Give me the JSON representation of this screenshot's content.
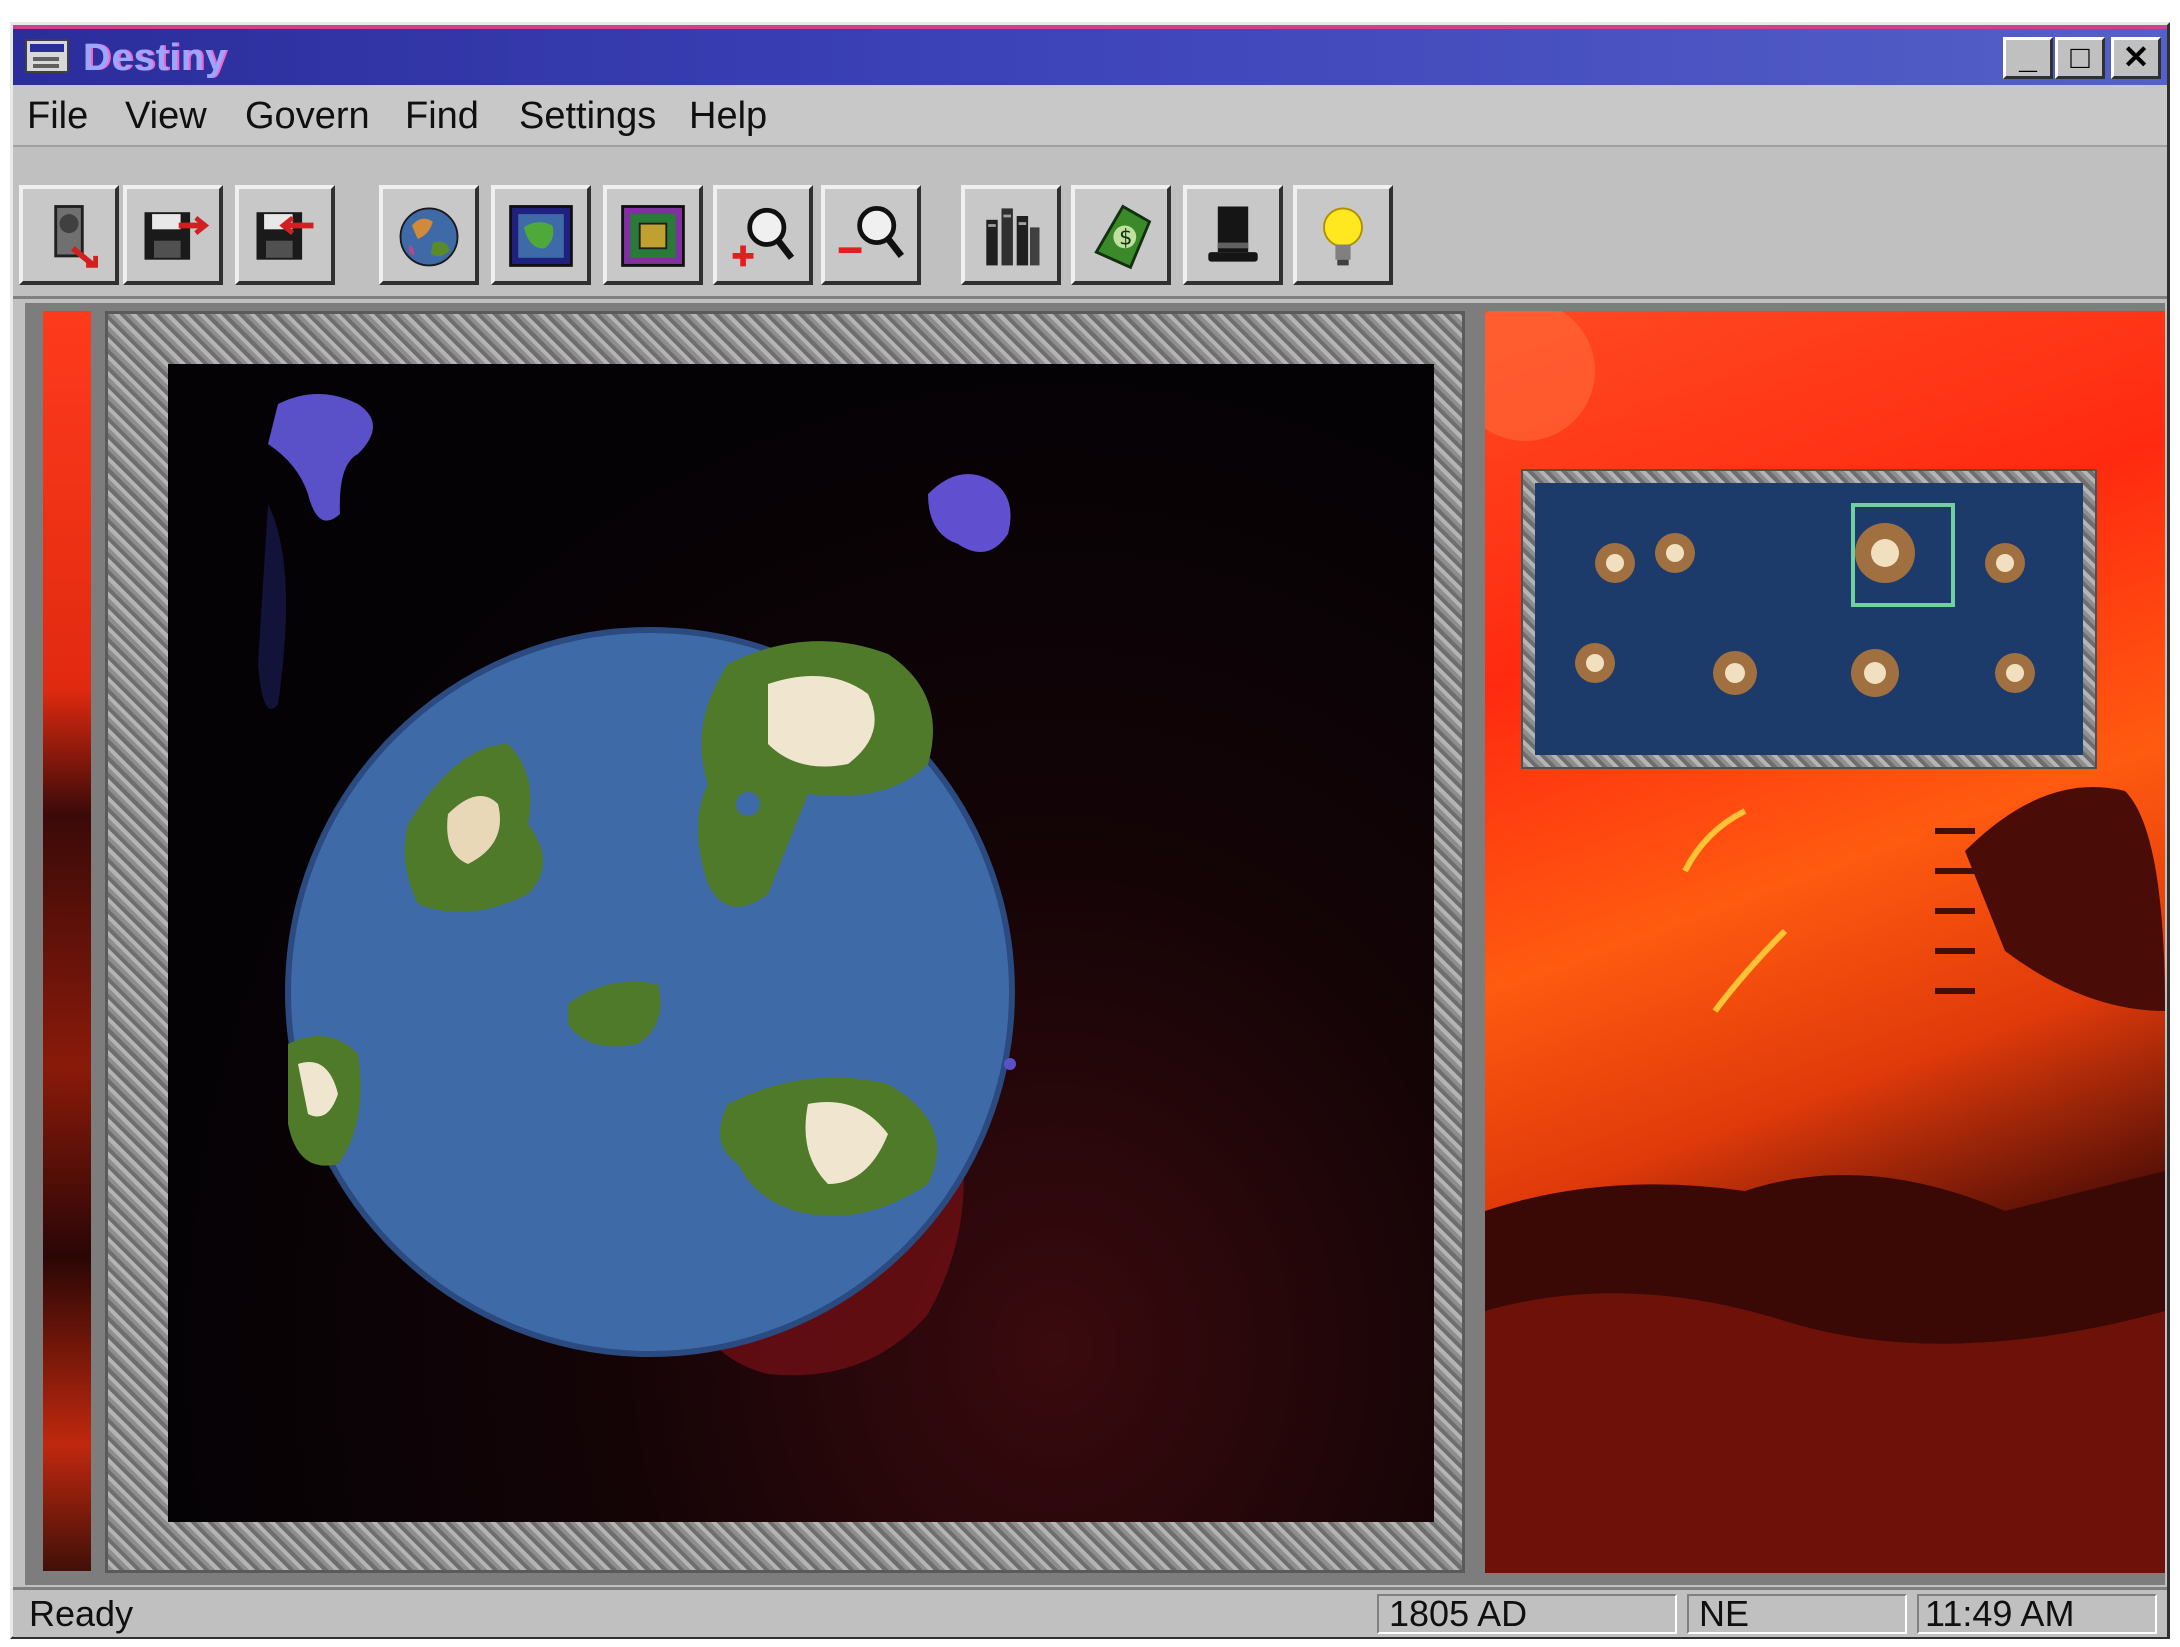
{
  "window": {
    "title": "Destiny",
    "controls": {
      "minimize": "_",
      "maximize": "□",
      "close": "✕"
    }
  },
  "menu": {
    "items": [
      {
        "label": "File"
      },
      {
        "label": "View"
      },
      {
        "label": "Govern"
      },
      {
        "label": "Find"
      },
      {
        "label": "Settings"
      },
      {
        "label": "Help"
      }
    ]
  },
  "toolbar": {
    "buttons": [
      "exit-game-icon",
      "save-icon",
      "load-icon",
      "globe-view-icon",
      "map-view-icon",
      "region-view-icon",
      "zoom-in-icon",
      "zoom-out-icon",
      "cities-icon",
      "finance-icon",
      "government-icon",
      "ideas-icon"
    ]
  },
  "status": {
    "message": "Ready",
    "year": "1805 AD",
    "direction": "NE",
    "time": "11:49 AM"
  },
  "colors": {
    "titlebar": "#3c42b8",
    "chrome": "#c0c0c0",
    "ocean": "#3f6aa8",
    "land": "#4f7a2a",
    "lava": "#ff3a1c"
  }
}
